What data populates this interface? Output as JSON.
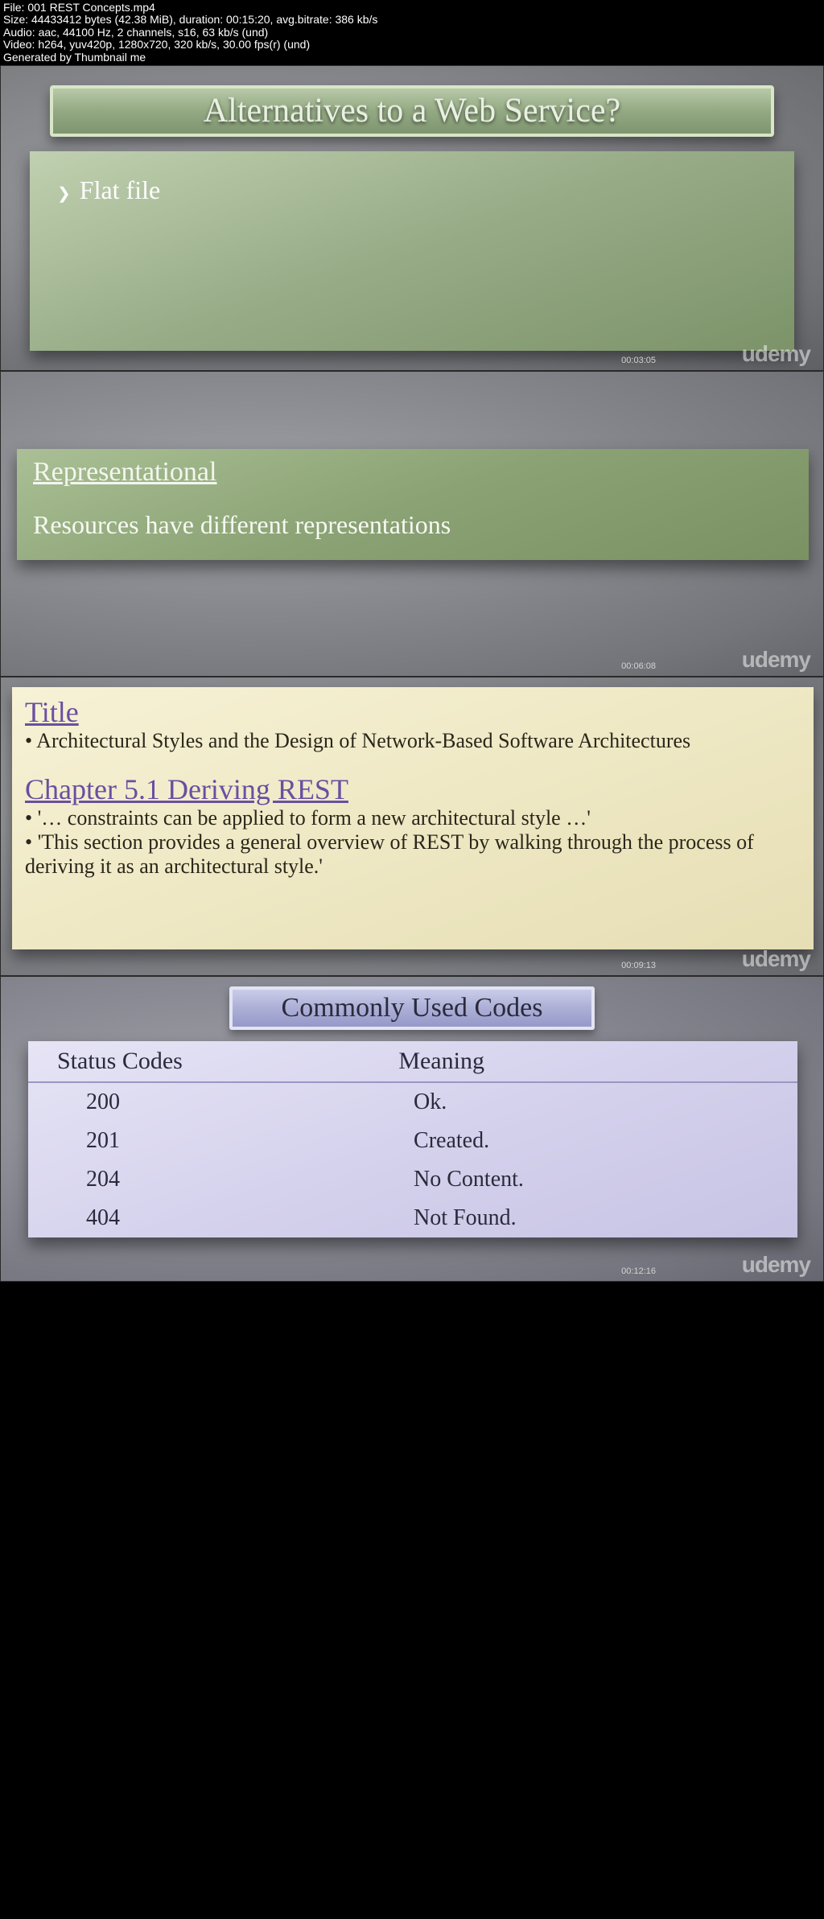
{
  "meta": {
    "file_line": "File: 001 REST Concepts.mp4",
    "size_line": "Size: 44433412 bytes (42.38 MiB), duration: 00:15:20, avg.bitrate: 386 kb/s",
    "audio_line": "Audio: aac, 44100 Hz, 2 channels, s16, 63 kb/s (und)",
    "video_line": "Video: h264, yuv420p, 1280x720, 320 kb/s, 30.00 fps(r) (und)",
    "gen_line": "Generated by Thumbnail me"
  },
  "logo": "udemy",
  "frame1": {
    "timestamp": "00:03:05",
    "title": "Alternatives to a Web Service?",
    "bullet": "Flat file"
  },
  "frame2": {
    "timestamp": "00:06:08",
    "heading": "Representational",
    "text": "Resources have different representations"
  },
  "frame3": {
    "timestamp": "00:09:13",
    "title_heading": "Title",
    "title_bullet": "• Architectural Styles and the Design of Network-Based Software Architectures",
    "chapter_heading": "Chapter 5.1 Deriving REST",
    "chapter_bullet1": "• '… constraints can be applied to form a new architectural style …'",
    "chapter_bullet2": "• 'This section provides a general overview of REST by walking through the process of deriving it as an architectural style.'"
  },
  "frame4": {
    "timestamp": "00:12:16",
    "title": "Commonly Used Codes",
    "header_code": "Status Codes",
    "header_meaning": "Meaning",
    "rows": [
      {
        "code": "200",
        "meaning": "Ok."
      },
      {
        "code": "201",
        "meaning": "Created."
      },
      {
        "code": "204",
        "meaning": "No Content."
      },
      {
        "code": "404",
        "meaning": "Not Found."
      }
    ]
  }
}
